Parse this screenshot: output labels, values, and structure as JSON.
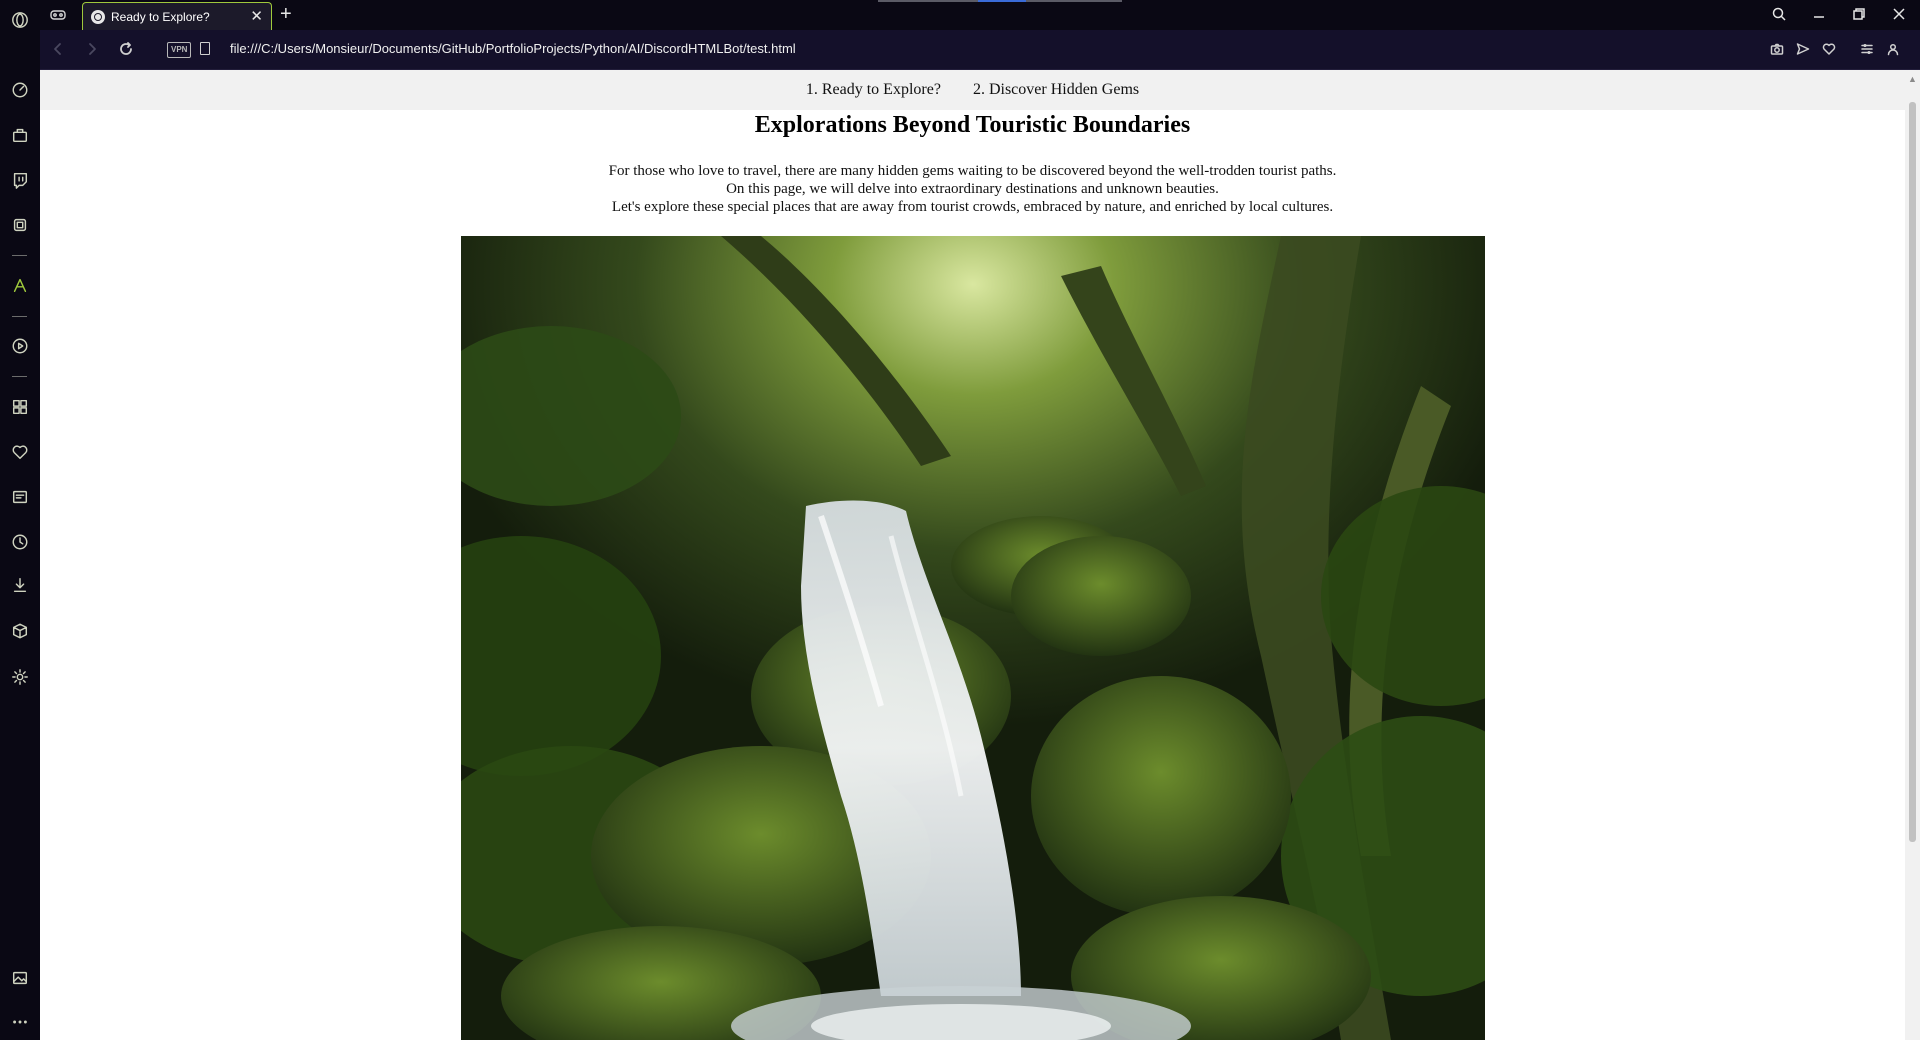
{
  "browser": {
    "tab": {
      "title": "Ready to Explore?"
    },
    "url": "file:///C:/Users/Monsieur/Documents/GitHub/PortfolioProjects/Python/AI/DiscordHTMLBot/test.html",
    "vpn_label": "VPN",
    "accent_color": "#9fc93c",
    "sidebar_icons": [
      "opera-logo-icon",
      "speed-dial-icon",
      "shopping-icon",
      "twitch-icon",
      "ai-icon",
      "aria-icon",
      "player-icon",
      "extensions-icon",
      "bookmarks-icon",
      "news-icon",
      "history-icon",
      "downloads-icon",
      "cube-icon",
      "settings-icon",
      "gallery-icon",
      "more-icon"
    ]
  },
  "page": {
    "nav": [
      {
        "label": "1. Ready to Explore?"
      },
      {
        "label": "2. Discover Hidden Gems"
      }
    ],
    "title": "Explorations Beyond Touristic Boundaries",
    "intro_lines": [
      "For those who love to travel, there are many hidden gems waiting to be discovered beyond the well-trodden tourist paths.",
      "On this page, we will delve into extraordinary destinations and unknown beauties.",
      "Let's explore these special places that are away from tourist crowds, embraced by nature, and enriched by local cultures."
    ],
    "hero_image": "forest waterfall"
  }
}
